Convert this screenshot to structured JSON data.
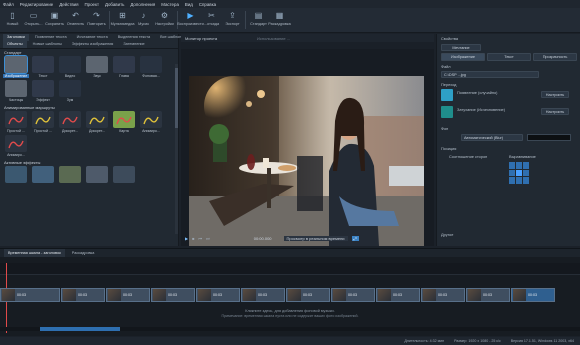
{
  "menu": [
    "Файл",
    "Редактирование",
    "Действия",
    "Проект",
    "Добавить",
    "Дополнения",
    "Мастера",
    "Вид",
    "Справка"
  ],
  "toolbar": [
    {
      "label": "Новый",
      "icon": "new-icon"
    },
    {
      "label": "Открыть...",
      "icon": "open-icon"
    },
    {
      "label": "Сохранить",
      "icon": "save-icon"
    },
    {
      "label": "Отменить",
      "icon": "undo-icon"
    },
    {
      "label": "Повторить",
      "icon": "redo-icon"
    },
    {
      "label": "Мультимедиа",
      "icon": "media-icon"
    },
    {
      "label": "Мусик",
      "icon": "music-icon"
    },
    {
      "label": "Настройки",
      "icon": "settings-icon"
    },
    {
      "label": "Воспроизвести",
      "icon": "play-icon"
    },
    {
      "label": "...отсада",
      "icon": "cut-icon"
    },
    {
      "label": "Экспорт",
      "icon": "export-icon"
    },
    {
      "label": "Стандарт",
      "icon": "standard-icon"
    },
    {
      "label": "Раскадровка",
      "icon": "storyboard-icon"
    }
  ],
  "left": {
    "tabs1": [
      "Заголовки",
      "Появление текста",
      "Исчезание текста",
      "Выделения текста",
      "Все шаблоны"
    ],
    "tabs2": [
      "Объекты",
      "Новые шаблоны",
      "Эффекты изображения",
      "Затемнение"
    ],
    "section1": "Стандарт",
    "thumbs1": [
      "Изображение",
      "Текст",
      "Видео",
      "Звук",
      "Глава",
      "Фоновая..."
    ],
    "thumbs1b": [
      "Частицы",
      "Эффект",
      "Зум"
    ],
    "section2": "Анимированные маршруты",
    "thumbs2": [
      "Простой ...",
      "Простой ...",
      "Дискрет...",
      "Дискрет...",
      "Карта",
      "Анимиро..."
    ],
    "thumbs2b": [
      "Анимиро..."
    ],
    "section3": "Активные эффекты"
  },
  "monitor": {
    "title": "Монитор проекта",
    "subtitle": "Использование ...",
    "time": "00:00.000",
    "mode": "Просмотр в реальном времени"
  },
  "right": {
    "title": "Свойства",
    "object": "Мечтание",
    "tabs": [
      "Изображение",
      "Текст",
      "Прозрачность"
    ],
    "file_label": "Файл",
    "file_value": "C:\\DSP ...jpg",
    "transition_label": "Переход",
    "transition_in": "Появление (случайно)",
    "transition_out": "Затухание (Исчезновение)",
    "btn_setup": "Настроить",
    "fill_label": "Фон",
    "fill_value": "Автоматический (Blur)",
    "position_label": "Позиция",
    "ratio_label": "Соотношение сторон",
    "align_label": "Выравнивание",
    "more_label": "Другое"
  },
  "timeline": {
    "tabs": [
      "Временная шкала - заголовок",
      "Раскадровка"
    ],
    "clips": [
      "00:03",
      "00:03",
      "00:03",
      "00:03",
      "00:03",
      "00:03",
      "00:03",
      "00:03",
      "00:03",
      "00:03",
      "00:03",
      "00:03"
    ],
    "hint1": "Кликните здесь, для добавления фоновой музыки.",
    "hint2": "Примечание: временная шкала пуста или не содержит ваших фото изображений."
  },
  "status": {
    "duration": "Длительность: 4:32 мин",
    "size": "Размер: 1920 x 1080 - 25 к/с",
    "version": "Версия 17.1.51, Windows 11 2003, x64"
  }
}
